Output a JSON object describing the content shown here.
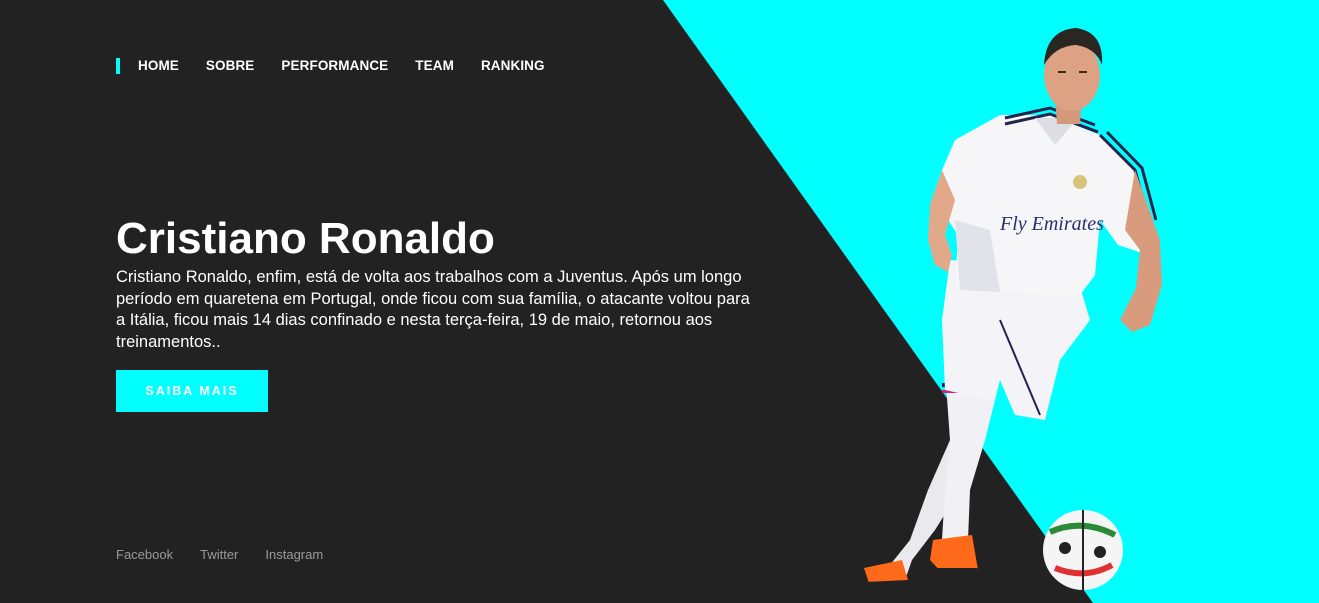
{
  "colors": {
    "background": "#222222",
    "accent": "#00ffff",
    "text": "#ffffff",
    "muted": "#9a9a9a"
  },
  "nav": {
    "items": [
      {
        "label": "HOME"
      },
      {
        "label": "SOBRE"
      },
      {
        "label": "PERFORMANCE"
      },
      {
        "label": "TEAM"
      },
      {
        "label": "RANKING"
      }
    ]
  },
  "hero": {
    "title": "Cristiano Ronaldo",
    "description": "Cristiano Ronaldo, enfim, está de volta aos trabalhos com a Juventus. Após um longo período em quaretena em Portugal, onde ficou com sua família, o atacante voltou para a Itália, ficou mais 14 dias confinado e nesta terça-feira, 19 de maio, retornou aos treinamentos..",
    "button_label": "SAIBA MAIS"
  },
  "social": {
    "links": [
      {
        "label": "Facebook"
      },
      {
        "label": "Twitter"
      },
      {
        "label": "Instagram"
      }
    ]
  },
  "player_image": {
    "jersey_text": "Fly Emirates"
  }
}
